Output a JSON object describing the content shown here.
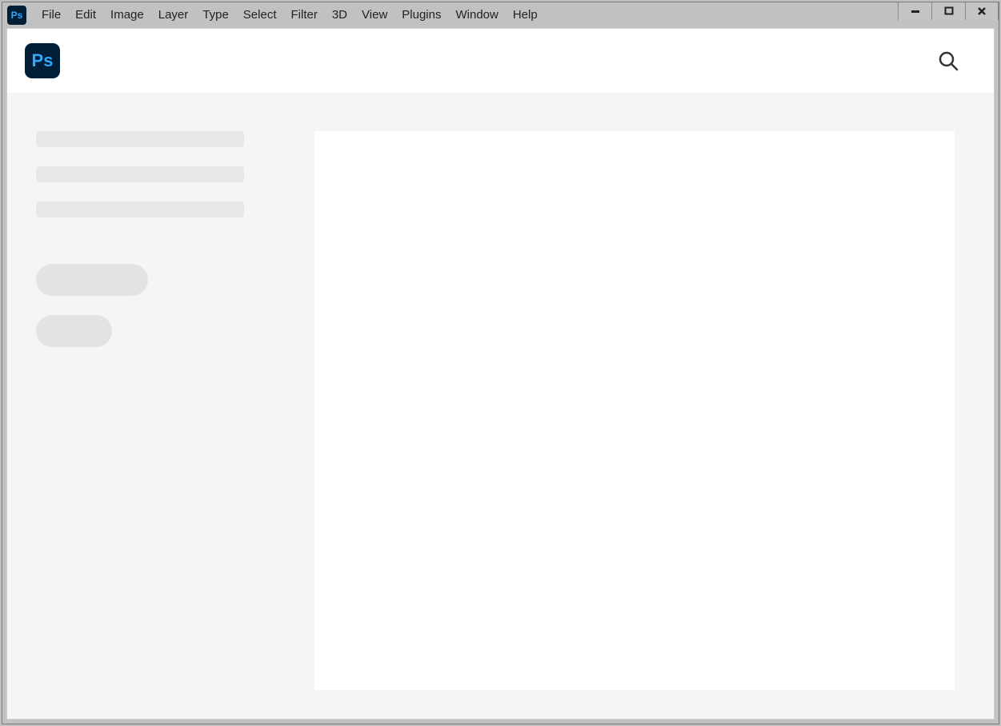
{
  "app_icon_text": "Ps",
  "logo_text": "Ps",
  "menu": {
    "items": [
      "File",
      "Edit",
      "Image",
      "Layer",
      "Type",
      "Select",
      "Filter",
      "3D",
      "View",
      "Plugins",
      "Window",
      "Help"
    ]
  }
}
